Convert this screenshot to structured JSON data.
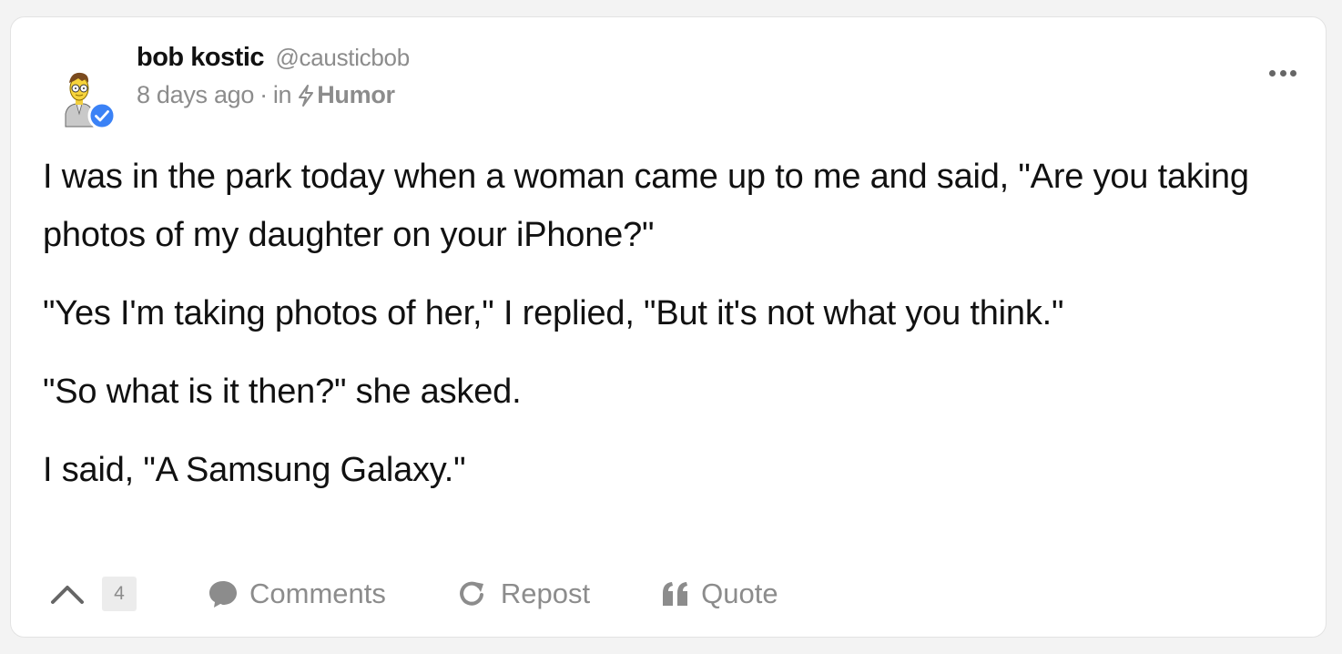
{
  "post": {
    "author": {
      "name": "bob kostic",
      "handle": "@causticbob",
      "verified": true
    },
    "timestamp": "8 days ago",
    "in_label": "in",
    "separator": "·",
    "category": "Humor",
    "paragraphs": [
      "I was in the park today when a woman came up to me and said, \"Are you taking photos of my daughter on your iPhone?\"",
      "\"Yes I'm taking photos of her,\" I replied, \"But it's not what you think.\"",
      "\"So what is it then?\" she asked.",
      "I said, \"A Samsung Galaxy.\""
    ]
  },
  "actions": {
    "upvote_count": "4",
    "comments_label": "Comments",
    "repost_label": "Repost",
    "quote_label": "Quote"
  },
  "icons": {
    "menu": "more-dots-icon",
    "upvote": "chevron-up-icon",
    "comments": "speech-bubble-icon",
    "repost": "refresh-arrow-icon",
    "quote": "quote-marks-icon",
    "category": "lightning-bolt-icon",
    "verified": "checkmark-badge-icon"
  },
  "colors": {
    "verified_badge": "#3b82f6",
    "muted_text": "#8c8c8c",
    "body_text": "#111111"
  }
}
